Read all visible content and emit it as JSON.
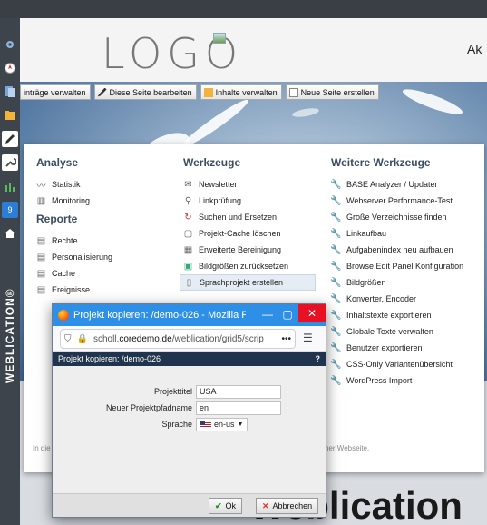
{
  "header": {
    "logo": "LOGO",
    "cut_text": "Ak"
  },
  "toolbar": {
    "items": [
      {
        "label": "inträge verwalten"
      },
      {
        "label": "Diese Seite bearbeiten"
      },
      {
        "label": "Inhalte verwalten"
      },
      {
        "label": "Neue Seite erstellen"
      }
    ]
  },
  "sidebar_brand": "WEBLICATION®",
  "menu": {
    "analyse": {
      "title": "Analyse",
      "items": [
        "Statistik",
        "Monitoring"
      ]
    },
    "reporte": {
      "title": "Reporte",
      "items": [
        "Rechte",
        "Personalisierung",
        "Cache",
        "Ereignisse"
      ]
    },
    "werkzeuge": {
      "title": "Werkzeuge",
      "items": [
        "Newsletter",
        "Linkprüfung",
        "Suchen und Ersetzen",
        "Projekt-Cache löschen",
        "Erweiterte Bereinigung",
        "Bildgrößen zurücksetzen",
        "Sprachprojekt erstellen"
      ]
    },
    "weitere": {
      "title": "Weitere Werkzeuge",
      "items": [
        "BASE Analyzer / Updater",
        "Webserver Performance-Test",
        "Große Verzeichnisse finden",
        "Linkaufbau",
        "Aufgabenindex neu aufbauen",
        "Browse Edit Panel Konfiguration",
        "Bildgrößen",
        "Konverter, Encoder",
        "Inhaltstexte exportieren",
        "Globale Texte verwalten",
        "Benutzer exportieren",
        "CSS-Only Variantenübersicht",
        "WordPress Import"
      ]
    },
    "footer_left": "In die",
    "footer_right": "ner Webseite."
  },
  "bigtext": "Weblication",
  "popup": {
    "window_title": "Projekt kopieren: /demo-026 - Mozilla F...",
    "url_prefix": "scholl.",
    "url_domain": "coredemo.de",
    "url_path": "/weblication/grid5/scrip",
    "url_more": "•••",
    "dialog_title": "Projekt kopieren: /demo-026",
    "help": "?",
    "fields": {
      "projekttitel_label": "Projekttitel",
      "projekttitel_value": "USA",
      "pfadname_label": "Neuer Projektpfadname",
      "pfadname_value": "en",
      "sprache_label": "Sprache",
      "sprache_value": "en-us"
    },
    "ok_label": "Ok",
    "cancel_label": "Abbrechen"
  }
}
